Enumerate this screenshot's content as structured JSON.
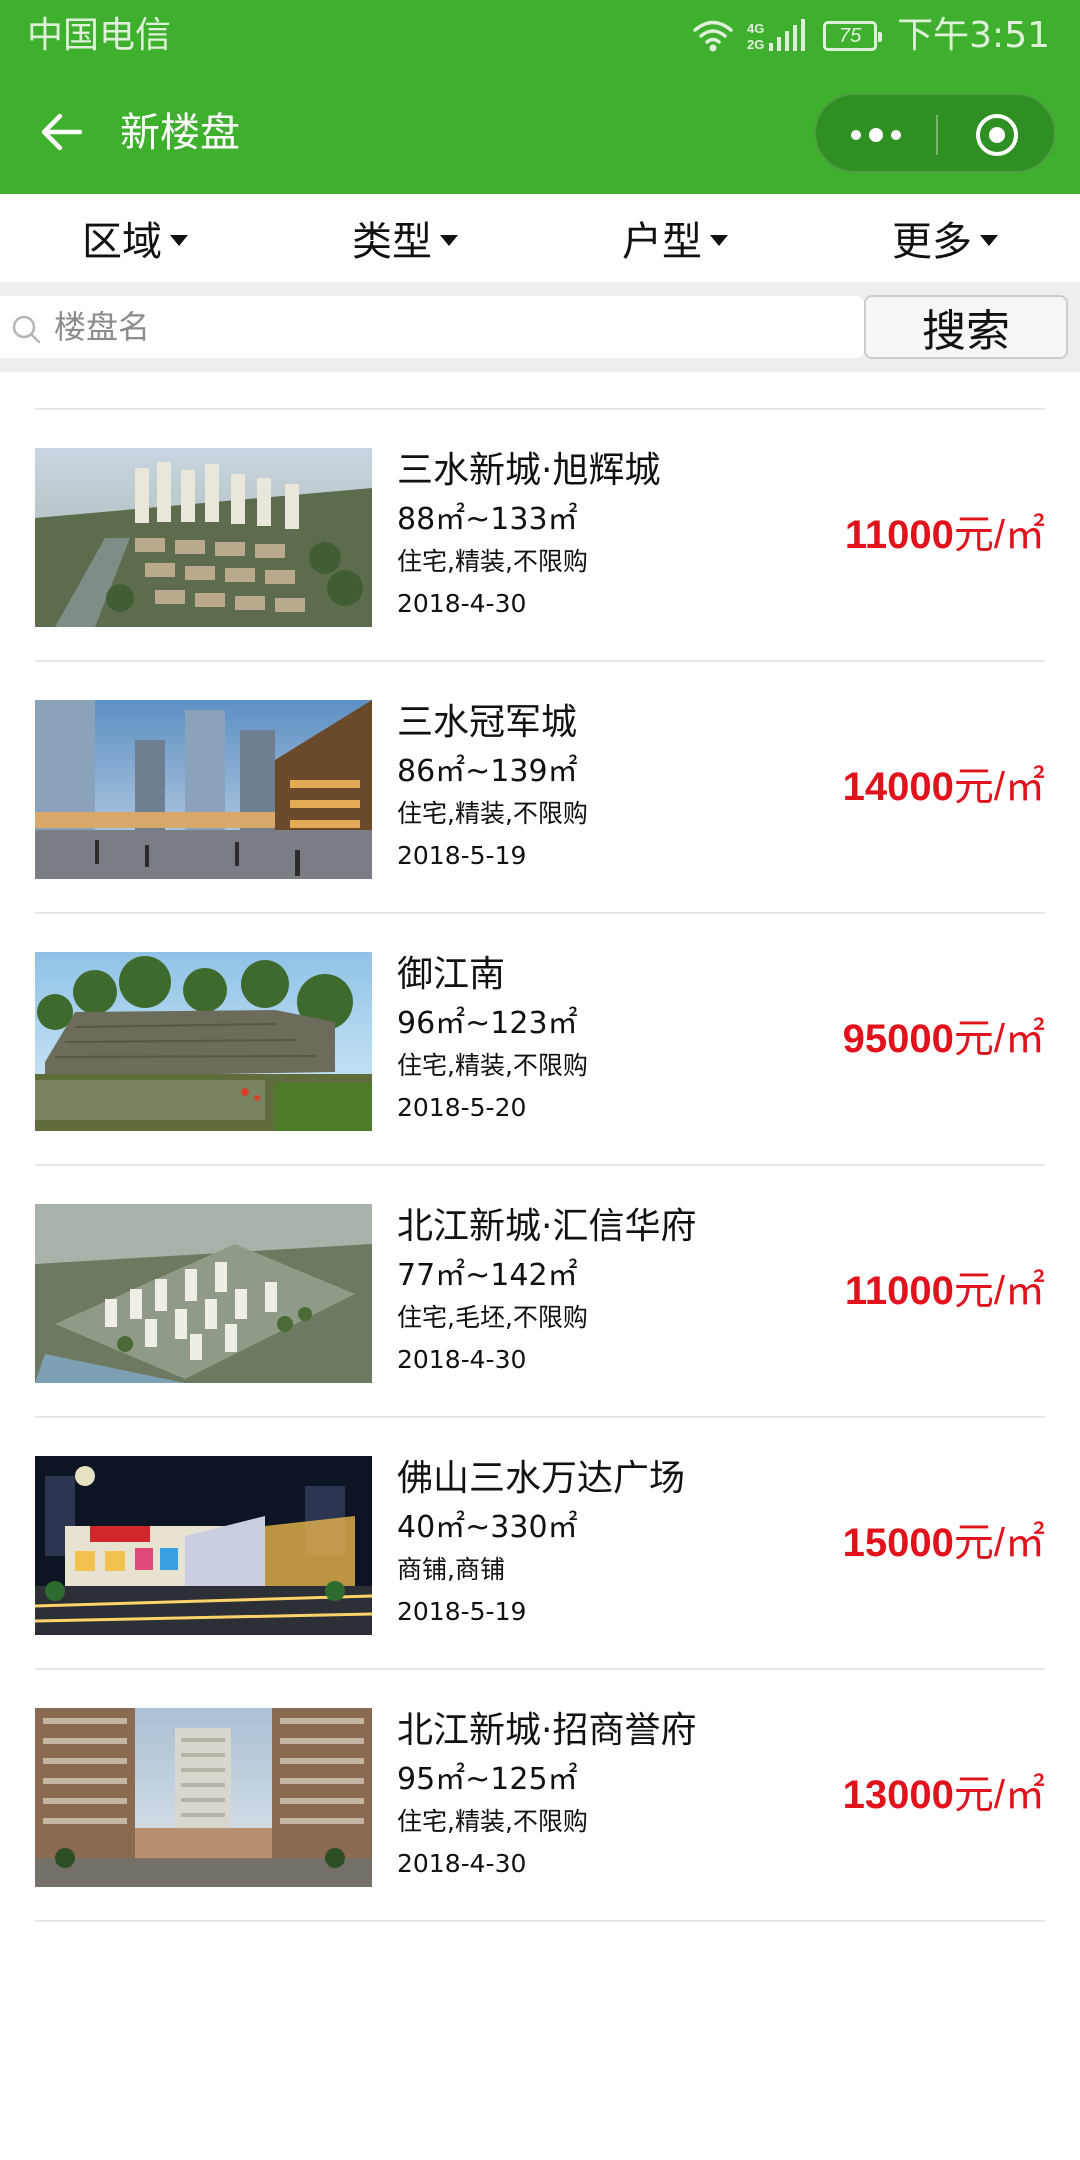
{
  "status_bar": {
    "carrier": "中国电信",
    "network": "4G 2G",
    "battery": "75",
    "time": "下午3:51"
  },
  "nav": {
    "title": "新楼盘"
  },
  "filters": [
    {
      "label": "区域"
    },
    {
      "label": "类型"
    },
    {
      "label": "户型"
    },
    {
      "label": "更多"
    }
  ],
  "search": {
    "placeholder": "楼盘名",
    "value": "",
    "button_label": "搜索"
  },
  "listings": [
    {
      "name": "三水新城·旭辉城",
      "area": "88㎡~133㎡",
      "tags": "住宅,精装,不限购",
      "date": "2018-4-30",
      "price": "11000",
      "unit": "元/㎡",
      "image": "aerial-residential-render"
    },
    {
      "name": "三水冠军城",
      "area": "86㎡~139㎡",
      "tags": "住宅,精装,不限购",
      "date": "2018-5-19",
      "price": "14000",
      "unit": "元/㎡",
      "image": "commercial-street-render"
    },
    {
      "name": "御江南",
      "area": "96㎡~123㎡",
      "tags": "住宅,精装,不限购",
      "date": "2018-5-20",
      "price": "95000",
      "unit": "元/㎡",
      "image": "landscape-wall-photo"
    },
    {
      "name": "北江新城·汇信华府",
      "area": "77㎡~142㎡",
      "tags": "住宅,毛坯,不限购",
      "date": "2018-4-30",
      "price": "11000",
      "unit": "元/㎡",
      "image": "aerial-compound-render"
    },
    {
      "name": "佛山三水万达广场",
      "area": "40㎡~330㎡",
      "tags": "商铺,商铺",
      "date": "2018-5-19",
      "price": "15000",
      "unit": "元/㎡",
      "image": "night-mall-photo"
    },
    {
      "name": "北江新城·招商誉府",
      "area": "95㎡~125㎡",
      "tags": "住宅,精装,不限购",
      "date": "2018-4-30",
      "price": "13000",
      "unit": "元/㎡",
      "image": "tower-street-render"
    }
  ]
}
